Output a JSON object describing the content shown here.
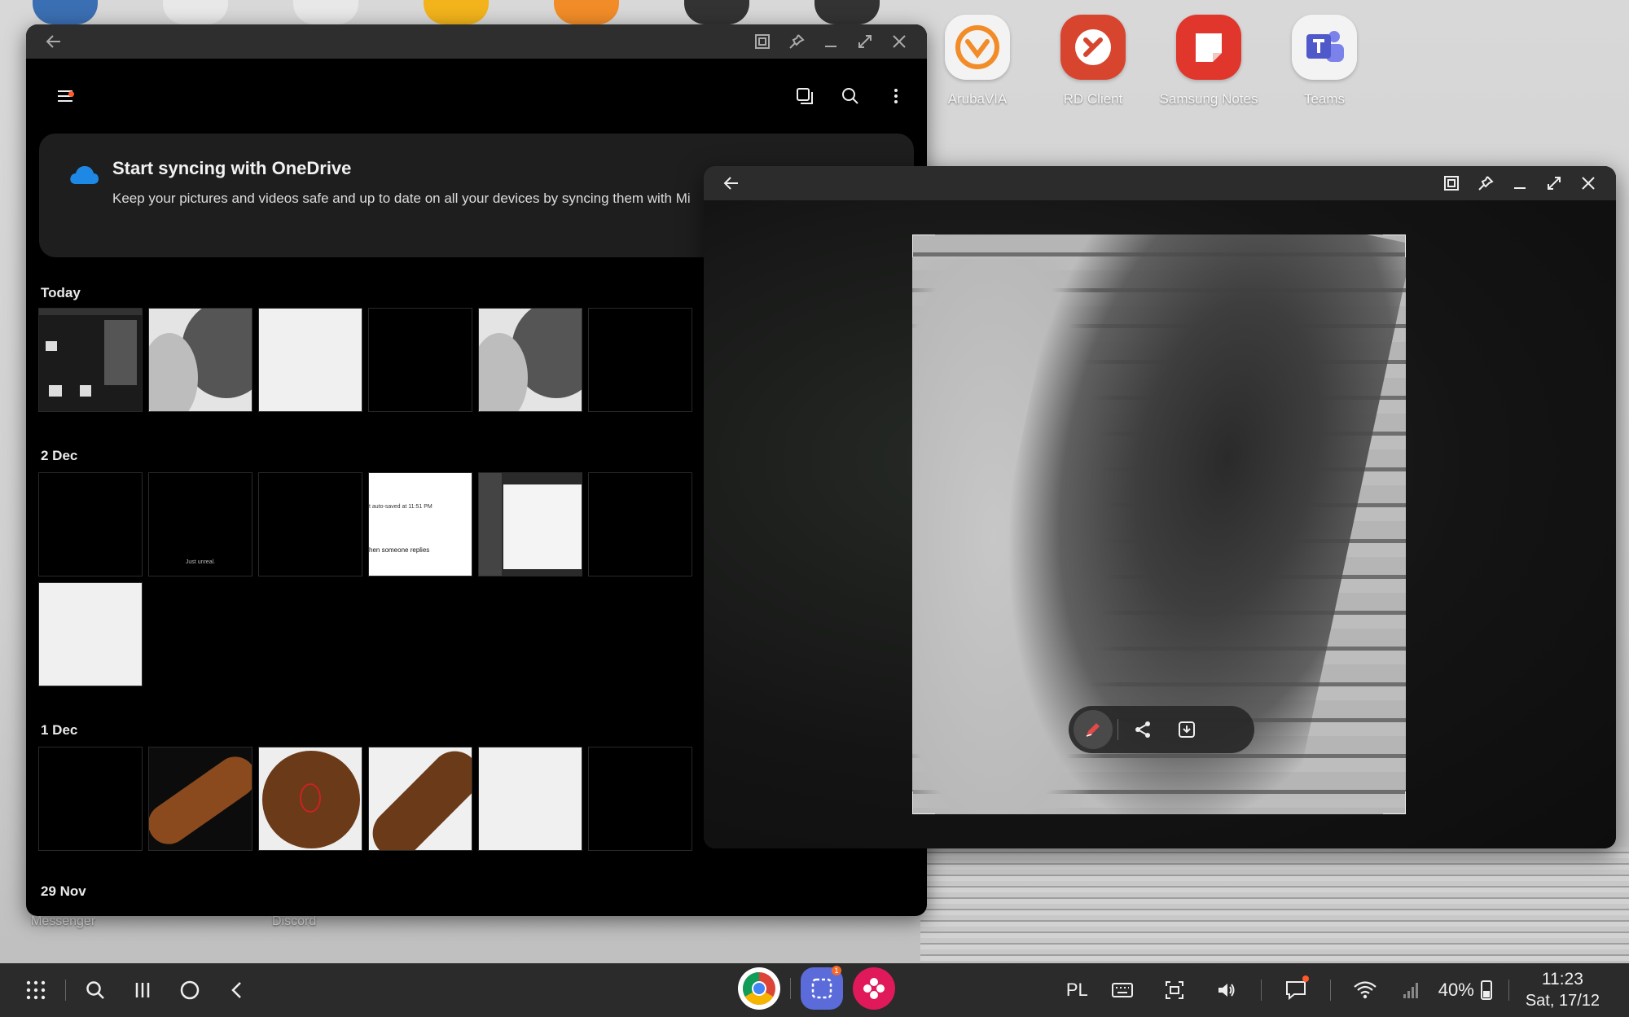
{
  "desktop": {
    "shortcuts": [
      {
        "label": "ArubaVIA",
        "icon": "arubavia-icon",
        "color": "#f28c28"
      },
      {
        "label": "RD Client",
        "icon": "rd-client-icon",
        "color": "#d8452e"
      },
      {
        "label": "Samsung Notes",
        "icon": "samsung-notes-icon",
        "color": "#e0362c"
      },
      {
        "label": "Teams",
        "icon": "teams-icon",
        "color": "#5059c9"
      }
    ],
    "partial_labels": {
      "messenger": "Messenger",
      "discord": "Discord"
    }
  },
  "gallery": {
    "sync_card": {
      "title": "Start syncing with OneDrive",
      "text": "Keep your pictures and videos safe and up to date on all your devices by syncing them with Mi"
    },
    "sections": [
      {
        "date": "Today"
      },
      {
        "date": "2 Dec"
      },
      {
        "date": "1 Dec"
      },
      {
        "date": "29 Nov"
      }
    ],
    "thumb_texts": {
      "just_unreal": "Just unreal.",
      "autosaved": "t auto-saved at 11:51 PM",
      "replies": "hen someone replies"
    }
  },
  "viewer": {
    "toolbar": [
      "edit-icon",
      "share-icon",
      "save-icon"
    ]
  },
  "taskbar": {
    "language": "PL",
    "battery": "40%",
    "time": "11:23",
    "date": "Sat, 17/12",
    "notification_badge": "1"
  },
  "colors": {
    "accent_orange": "#ff5a2a",
    "onedrive_blue": "#1e88e5",
    "edit_red": "#e24a4a"
  }
}
